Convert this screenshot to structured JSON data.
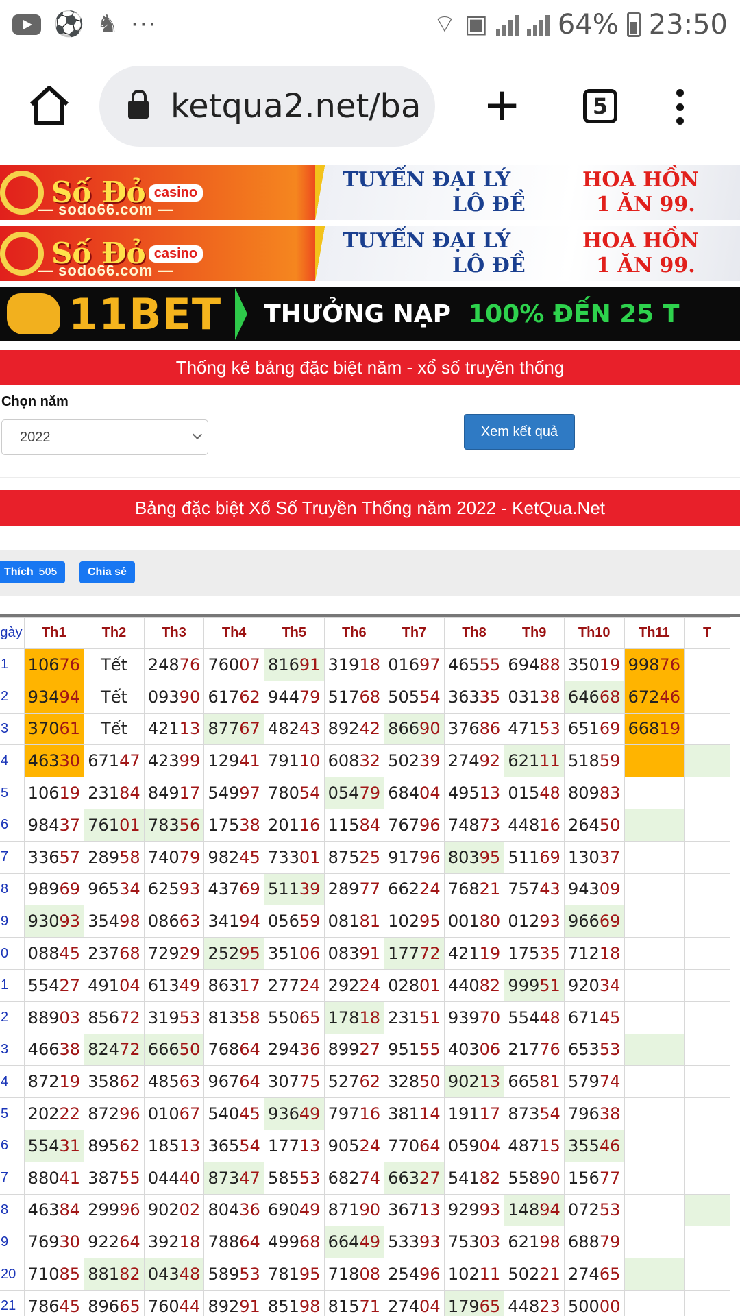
{
  "status_bar": {
    "battery": "64%",
    "time": "23:50",
    "overflow": "···"
  },
  "browser": {
    "url": "ketqua2.net/ba",
    "tab_count": "5"
  },
  "banners": {
    "sodo": {
      "brand": "Số Đỏ",
      "casino": "casino",
      "site": "— sodo66.com —",
      "line1": "TUYỂN ĐẠI LÝ",
      "line2": "LÔ ĐỀ",
      "line3": "HOA HỒN",
      "line4": "1 ĂN 99."
    },
    "bet11": {
      "brand": "11BET",
      "promo_a": "THƯỞNG NẠP",
      "promo_b": "100% ĐẾN 25 T"
    }
  },
  "headers": {
    "stats_title": "Thống kê bảng đặc biệt năm - xổ số truyền thống",
    "table_title": "Bảng đặc biệt Xổ Số Truyền Thống năm 2022 - KetQua.Net"
  },
  "form": {
    "label": "Chọn năm",
    "year": "2022",
    "button": "Xem kết quả"
  },
  "social": {
    "like": "Thích",
    "like_count": "505",
    "share": "Chia sẻ"
  },
  "table": {
    "day_header": "gày",
    "months": [
      "Th1",
      "Th2",
      "Th3",
      "Th4",
      "Th5",
      "Th6",
      "Th7",
      "Th8",
      "Th9",
      "Th10",
      "Th11",
      "T"
    ],
    "day_labels": [
      "1",
      "2",
      "3",
      "4",
      "5",
      "6",
      "7",
      "8",
      "9",
      "0",
      "1",
      "2",
      "3",
      "4",
      "5",
      "6",
      "7",
      "8",
      "9",
      "20",
      "21"
    ],
    "rows": [
      [
        "10676",
        "Tết",
        "24876",
        "76007",
        "81691",
        "31918",
        "01697",
        "46555",
        "69488",
        "35019",
        "99876",
        ""
      ],
      [
        "93494",
        "Tết",
        "09390",
        "61762",
        "94479",
        "51768",
        "50554",
        "36335",
        "03138",
        "64668",
        "67246",
        ""
      ],
      [
        "37061",
        "Tết",
        "42113",
        "87767",
        "48243",
        "89242",
        "86690",
        "37686",
        "47153",
        "65169",
        "66819",
        ""
      ],
      [
        "46330",
        "67147",
        "42399",
        "12941",
        "79110",
        "60832",
        "50239",
        "27492",
        "62111",
        "51859",
        "",
        ""
      ],
      [
        "10619",
        "23184",
        "84917",
        "54997",
        "78054",
        "05479",
        "68404",
        "49513",
        "01548",
        "80983",
        "",
        ""
      ],
      [
        "98437",
        "76101",
        "78356",
        "17538",
        "20116",
        "11584",
        "76796",
        "74873",
        "44816",
        "26450",
        "",
        ""
      ],
      [
        "33657",
        "28958",
        "74079",
        "98245",
        "73301",
        "87525",
        "91796",
        "80395",
        "51169",
        "13037",
        "",
        ""
      ],
      [
        "98969",
        "96534",
        "62593",
        "43769",
        "51139",
        "28977",
        "66224",
        "76821",
        "75743",
        "94309",
        "",
        ""
      ],
      [
        "93093",
        "35498",
        "08663",
        "34194",
        "05659",
        "08181",
        "10295",
        "00180",
        "01293",
        "96669",
        "",
        ""
      ],
      [
        "08845",
        "23768",
        "72929",
        "25295",
        "35106",
        "08391",
        "17772",
        "42119",
        "17535",
        "71218",
        "",
        ""
      ],
      [
        "55427",
        "49104",
        "61349",
        "86317",
        "27724",
        "29224",
        "02801",
        "44082",
        "99951",
        "92034",
        "",
        ""
      ],
      [
        "88903",
        "85672",
        "31953",
        "81358",
        "55065",
        "17818",
        "23151",
        "93970",
        "55448",
        "67145",
        "",
        ""
      ],
      [
        "46638",
        "82472",
        "66650",
        "76864",
        "29436",
        "89927",
        "95155",
        "40306",
        "21776",
        "65353",
        "",
        ""
      ],
      [
        "87219",
        "35862",
        "48563",
        "96764",
        "30775",
        "52762",
        "32850",
        "90213",
        "66581",
        "57974",
        "",
        ""
      ],
      [
        "20222",
        "87296",
        "01067",
        "54045",
        "93649",
        "79716",
        "38114",
        "19117",
        "87354",
        "79638",
        "",
        ""
      ],
      [
        "55431",
        "89562",
        "18513",
        "36554",
        "17713",
        "90524",
        "77064",
        "05904",
        "48715",
        "35546",
        "",
        ""
      ],
      [
        "88041",
        "38755",
        "04440",
        "87347",
        "58553",
        "68274",
        "66327",
        "54182",
        "55890",
        "15677",
        "",
        ""
      ],
      [
        "46384",
        "29996",
        "90202",
        "80436",
        "69049",
        "87190",
        "36713",
        "92993",
        "14894",
        "07253",
        "",
        ""
      ],
      [
        "76930",
        "92264",
        "39218",
        "78864",
        "49968",
        "66449",
        "53393",
        "75303",
        "62198",
        "68879",
        "",
        ""
      ],
      [
        "71085",
        "88182",
        "04348",
        "58953",
        "78195",
        "71808",
        "25496",
        "10211",
        "50221",
        "27465",
        "",
        ""
      ],
      [
        "78645",
        "89665",
        "76044",
        "89291",
        "85198",
        "81571",
        "27404",
        "17965",
        "44823",
        "50000",
        "",
        ""
      ]
    ],
    "highlight_orange": [
      [
        0,
        0
      ],
      [
        1,
        0
      ],
      [
        2,
        0
      ],
      [
        3,
        0
      ],
      [
        0,
        10
      ],
      [
        1,
        10
      ],
      [
        2,
        10
      ],
      [
        3,
        10
      ]
    ],
    "highlight_green": [
      [
        0,
        4
      ],
      [
        1,
        9
      ],
      [
        2,
        3
      ],
      [
        2,
        6
      ],
      [
        3,
        8
      ],
      [
        3,
        11
      ],
      [
        4,
        5
      ],
      [
        5,
        1
      ],
      [
        5,
        2
      ],
      [
        5,
        10
      ],
      [
        6,
        7
      ],
      [
        7,
        4
      ],
      [
        8,
        0
      ],
      [
        8,
        9
      ],
      [
        9,
        3
      ],
      [
        9,
        6
      ],
      [
        10,
        8
      ],
      [
        11,
        5
      ],
      [
        12,
        1
      ],
      [
        12,
        2
      ],
      [
        12,
        10
      ],
      [
        13,
        7
      ],
      [
        14,
        4
      ],
      [
        15,
        0
      ],
      [
        15,
        9
      ],
      [
        16,
        3
      ],
      [
        16,
        6
      ],
      [
        17,
        8
      ],
      [
        17,
        11
      ],
      [
        18,
        5
      ],
      [
        19,
        1
      ],
      [
        19,
        2
      ],
      [
        19,
        10
      ],
      [
        20,
        7
      ]
    ]
  }
}
